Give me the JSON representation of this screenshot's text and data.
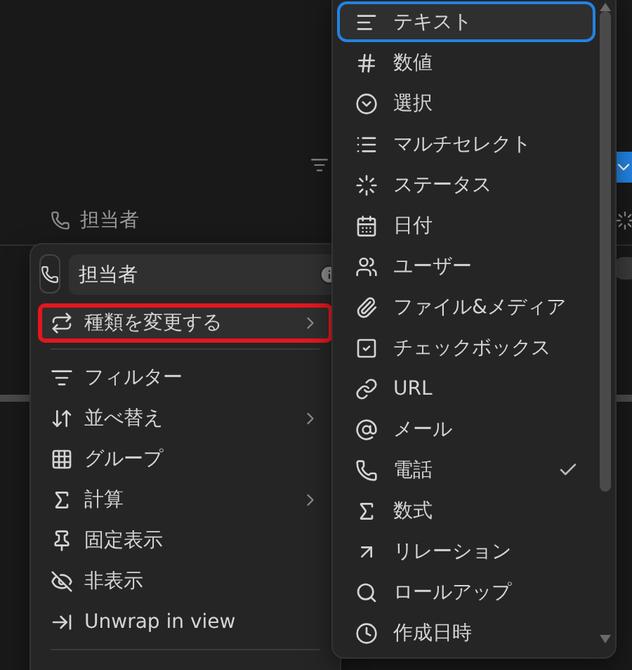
{
  "column_header": {
    "label": "担当者"
  },
  "property_menu": {
    "name_value": "担当者",
    "items": [
      {
        "label": "種類を変更する",
        "submenu": true,
        "highlighted": true
      },
      {
        "label": "フィルター",
        "submenu": false,
        "highlighted": false
      },
      {
        "label": "並べ替え",
        "submenu": true,
        "highlighted": false
      },
      {
        "label": "グループ",
        "submenu": false,
        "highlighted": false
      },
      {
        "label": "計算",
        "submenu": true,
        "highlighted": false
      },
      {
        "label": "固定表示",
        "submenu": false,
        "highlighted": false
      },
      {
        "label": "非表示",
        "submenu": false,
        "highlighted": false
      },
      {
        "label": "Unwrap in view",
        "submenu": false,
        "highlighted": false
      }
    ]
  },
  "type_menu": {
    "items": [
      {
        "label": "テキスト",
        "selected": true,
        "checked": false
      },
      {
        "label": "数値",
        "selected": false,
        "checked": false
      },
      {
        "label": "選択",
        "selected": false,
        "checked": false
      },
      {
        "label": "マルチセレクト",
        "selected": false,
        "checked": false
      },
      {
        "label": "ステータス",
        "selected": false,
        "checked": false
      },
      {
        "label": "日付",
        "selected": false,
        "checked": false
      },
      {
        "label": "ユーザー",
        "selected": false,
        "checked": false
      },
      {
        "label": "ファイル&メディア",
        "selected": false,
        "checked": false
      },
      {
        "label": "チェックボックス",
        "selected": false,
        "checked": false
      },
      {
        "label": "URL",
        "selected": false,
        "checked": false
      },
      {
        "label": "メール",
        "selected": false,
        "checked": false
      },
      {
        "label": "電話",
        "selected": false,
        "checked": true
      },
      {
        "label": "数式",
        "selected": false,
        "checked": false
      },
      {
        "label": "リレーション",
        "selected": false,
        "checked": false
      },
      {
        "label": "ロールアップ",
        "selected": false,
        "checked": false
      },
      {
        "label": "作成日時",
        "selected": false,
        "checked": false
      }
    ]
  }
}
